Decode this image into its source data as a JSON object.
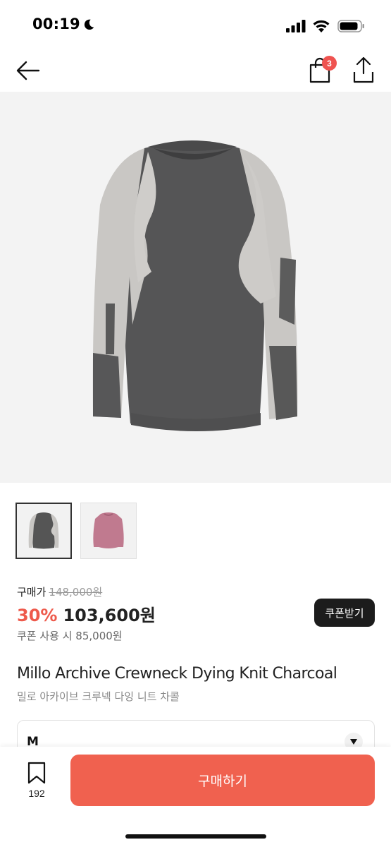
{
  "status_bar": {
    "time": "00:19",
    "icons": [
      "moon-icon",
      "signal-icon",
      "wifi-icon",
      "battery-icon"
    ]
  },
  "nav": {
    "back_icon": "arrow-left-icon",
    "cart_icon": "shopping-bag-icon",
    "cart_count": "3",
    "share_icon": "share-icon"
  },
  "thumbnails": [
    {
      "name": "charcoal sweater",
      "selected": true
    },
    {
      "name": "pink sweater",
      "selected": false
    }
  ],
  "price": {
    "label": "구매가",
    "original": "148,000원",
    "discount_rate": "30%",
    "sale": "103,600원",
    "coupon_button": "쿠폰받기",
    "coupon_price": "쿠폰 사용 시 85,000원"
  },
  "product": {
    "title": "Millo Archive Crewneck Dying Knit Charcoal",
    "subtitle": "밀로 아카이브 크루넥 다잉 니트 차콜"
  },
  "option": {
    "selected": "M"
  },
  "bottom_bar": {
    "wish_count": "192",
    "buy_label": "구매하기"
  },
  "colors": {
    "accent": "#f0614f",
    "discount": "#ee5a4c",
    "badge": "#ef5350",
    "coupon_button": "#1c1c1c"
  }
}
